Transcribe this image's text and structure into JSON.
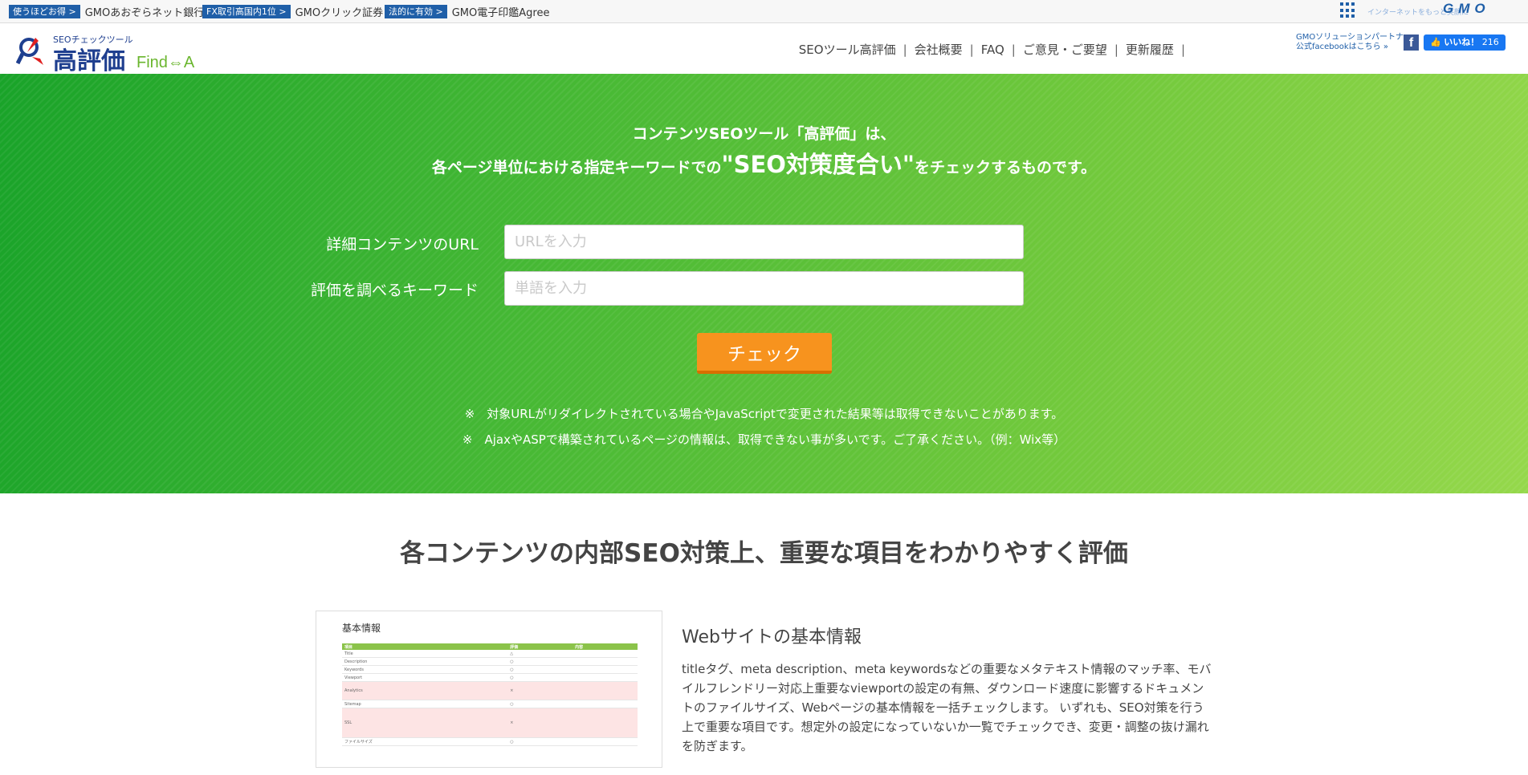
{
  "topbar": {
    "promos": [
      {
        "tag": "使うほどお得 >",
        "text": "GMOあおぞらネット銀行"
      },
      {
        "tag": "FX取引高国内1位 >",
        "text": "GMOクリック証券"
      },
      {
        "tag": "法的に有効 >",
        "text": "GMO電子印鑑Agree"
      }
    ],
    "gmo_tagline": "インターネットをもっと笑顔に",
    "gmo_logo": "GMO"
  },
  "header": {
    "logo_sub": "SEOチェックツール",
    "logo_main": "高評価",
    "logo_find": "Find⇔A",
    "nav": [
      "SEOツール高評価",
      "会社概要",
      "FAQ",
      "ご意見・ご要望",
      "更新履歴"
    ],
    "partner_line1": "GMOソリューションパートナー",
    "partner_line2": "公式facebookはこちら »",
    "fb_like_label": "いいね！",
    "fb_like_count": "216"
  },
  "hero": {
    "intro_line1": "コンテンツSEOツール「高評価」は、",
    "intro_line2_pre": "各ページ単位における指定キーワードでの",
    "intro_line2_big": "\"SEO対策度合い\"",
    "intro_line2_post": "をチェックするものです。",
    "url_label": "詳細コンテンツのURL",
    "url_placeholder": "URLを入力",
    "keyword_label": "評価を調べるキーワード",
    "keyword_placeholder": "単語を入力",
    "check_button": "チェック",
    "note1": "※　対象URLがリダイレクトされている場合やJavaScriptで変更された結果等は取得できないことがあります。",
    "note2": "※　AjaxやASPで構築されているページの情報は、取得できない事が多いです。ご了承ください。（例：Wix等）"
  },
  "section": {
    "title": "各コンテンツの内部SEO対策上、重要な項目をわかりやすく評価",
    "thumb_title": "基本情報",
    "thumb_headers": [
      "項目",
      "評価",
      "内容"
    ],
    "thumb_rows": [
      {
        "item": "Title",
        "grade": "△",
        "warn": false
      },
      {
        "item": "Description",
        "grade": "○",
        "warn": false
      },
      {
        "item": "Keywords",
        "grade": "○",
        "warn": false
      },
      {
        "item": "Viewport",
        "grade": "○",
        "warn": false
      },
      {
        "item": "Analytics",
        "grade": "×",
        "warn": true
      },
      {
        "item": "Sitemap",
        "grade": "○",
        "warn": false
      },
      {
        "item": "SSL",
        "grade": "×",
        "warn": true
      },
      {
        "item": "ファイルサイズ",
        "grade": "○",
        "warn": false
      }
    ],
    "feature_title": "Webサイトの基本情報",
    "feature_body": "titleタグ、meta description、meta keywordsなどの重要なメタテキスト情報のマッチ率、モバイルフレンドリー対応上重要なviewportの設定の有無、ダウンロード速度に影響するドキュメントのファイルサイズ、Webページの基本情報を一括チェックします。 いずれも、SEO対策を行う上で重要な項目です。想定外の設定になっていないか一覧でチェックでき、変更・調整の抜け漏れを防ぎます。"
  },
  "colors": {
    "brand_blue": "#1f3f8f",
    "hero_green_start": "#19a329",
    "hero_green_end": "#95d84b",
    "check_orange": "#f7931e"
  }
}
